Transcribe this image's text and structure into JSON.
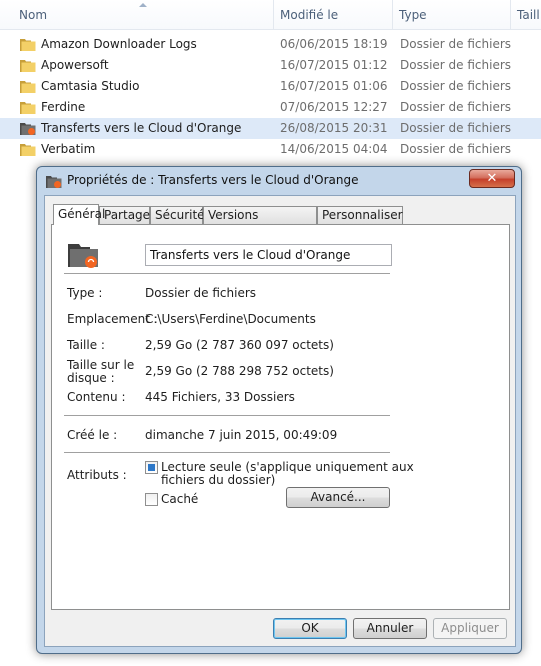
{
  "explorer": {
    "columns": {
      "name": "Nom",
      "modified": "Modifié le",
      "type": "Type",
      "size": "Taill"
    },
    "rows": [
      {
        "name": "Amazon Downloader Logs",
        "modified": "06/06/2015 18:19",
        "type": "Dossier de fichiers"
      },
      {
        "name": "Apowersoft",
        "modified": "16/07/2015 01:12",
        "type": "Dossier de fichiers"
      },
      {
        "name": "Camtasia Studio",
        "modified": "16/07/2015 01:06",
        "type": "Dossier de fichiers"
      },
      {
        "name": "Ferdine",
        "modified": "07/06/2015 12:27",
        "type": "Dossier de fichiers"
      },
      {
        "name": "Transferts vers le Cloud d'Orange",
        "modified": "26/08/2015 20:31",
        "type": "Dossier de fichiers"
      },
      {
        "name": "Verbatim",
        "modified": "14/06/2015 04:04",
        "type": "Dossier de fichiers"
      }
    ]
  },
  "dialog": {
    "title": "Propriétés de : Transferts vers le Cloud d'Orange",
    "close_glyph": "✕",
    "tabs": [
      "Général",
      "Partage",
      "Sécurité",
      "Versions précédentes",
      "Personnaliser"
    ],
    "folder_name": "Transferts vers le Cloud d'Orange",
    "properties": {
      "type_label": "Type :",
      "type_value": "Dossier de fichiers",
      "location_label": "Emplacement :",
      "location_value": "C:\\Users\\Ferdine\\Documents",
      "size_label": "Taille :",
      "size_value": "2,59 Go (2 787 360 097 octets)",
      "disk_size_label_1": "Taille sur le",
      "disk_size_label_2": "disque :",
      "disk_size_value": "2,59 Go (2 788 298 752 octets)",
      "contents_label": "Contenu :",
      "contents_value": "445 Fichiers, 33 Dossiers",
      "created_label": "Créé le :",
      "created_value": "dimanche 7 juin 2015, 00:49:09",
      "attributes_label": "Attributs :"
    },
    "attributes": {
      "readonly_line1": "Lecture seule (s'applique uniquement aux",
      "readonly_line2": "fichiers du dossier)",
      "hidden": "Caché",
      "advanced": "Avancé..."
    },
    "buttons": {
      "ok": "OK",
      "cancel": "Annuler",
      "apply": "Appliquer"
    },
    "colors": {
      "titlebar": "#c3d6ea",
      "close": "#c5402b",
      "checkbox_fill": "#2d78c8",
      "cloud_badge": "#f26522"
    }
  }
}
